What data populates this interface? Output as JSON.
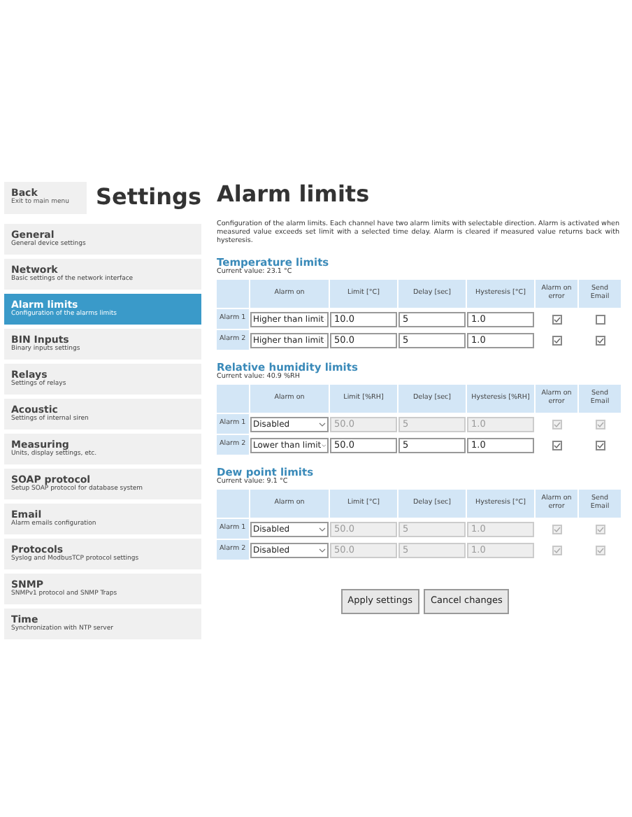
{
  "back": {
    "title": "Back",
    "subtitle": "Exit to main menu"
  },
  "settings_title": "Settings",
  "sidebar": {
    "items": [
      {
        "title": "General",
        "subtitle": "General device settings",
        "selected": false
      },
      {
        "title": "Network",
        "subtitle": "Basic settings of the network interface",
        "selected": false
      },
      {
        "title": "Alarm limits",
        "subtitle": "Configuration of the alarms limits",
        "selected": true
      },
      {
        "title": "BIN Inputs",
        "subtitle": "Binary inputs settings",
        "selected": false
      },
      {
        "title": "Relays",
        "subtitle": "Settings of relays",
        "selected": false
      },
      {
        "title": "Acoustic",
        "subtitle": "Settings of internal siren",
        "selected": false
      },
      {
        "title": "Measuring",
        "subtitle": "Units, display settings, etc.",
        "selected": false
      },
      {
        "title": "SOAP protocol",
        "subtitle": "Setup SOAP protocol for database system",
        "selected": false
      },
      {
        "title": "Email",
        "subtitle": "Alarm emails configuration",
        "selected": false
      },
      {
        "title": "Protocols",
        "subtitle": "Syslog and ModbusTCP protocol settings",
        "selected": false
      },
      {
        "title": "SNMP",
        "subtitle": "SNMPv1 protocol and SNMP Traps",
        "selected": false
      },
      {
        "title": "Time",
        "subtitle": "Synchronization with NTP server",
        "selected": false
      }
    ]
  },
  "page_title": "Alarm limits",
  "description": "Configuration of the alarm limits. Each channel have two alarm limits with selectable direction. Alarm is activated when measured value exceeds set limit with a selected time delay. Alarm is cleared if measured value returns back with hysteresis.",
  "sections": [
    {
      "title": "Temperature limits",
      "current": "Current value: 23.1 °C",
      "columns": [
        "Alarm on",
        "Limit [°C]",
        "Delay [sec]",
        "Hysteresis [°C]",
        "Alarm on error",
        "Send Email"
      ],
      "rows": [
        {
          "label": "Alarm 1",
          "alarm_on": "Higher than limit",
          "limit": "10.0",
          "delay": "5",
          "hysteresis": "1.0",
          "disabled": false,
          "alarm_on_error": true,
          "send_email": false
        },
        {
          "label": "Alarm 2",
          "alarm_on": "Higher than limit",
          "limit": "50.0",
          "delay": "5",
          "hysteresis": "1.0",
          "disabled": false,
          "alarm_on_error": true,
          "send_email": true
        }
      ]
    },
    {
      "title": "Relative humidity limits",
      "current": "Current value: 40.9 %RH",
      "columns": [
        "Alarm on",
        "Limit [%RH]",
        "Delay [sec]",
        "Hysteresis [%RH]",
        "Alarm on error",
        "Send Email"
      ],
      "rows": [
        {
          "label": "Alarm 1",
          "alarm_on": "Disabled",
          "limit": "50.0",
          "delay": "5",
          "hysteresis": "1.0",
          "disabled": true,
          "alarm_on_error": true,
          "send_email": true
        },
        {
          "label": "Alarm 2",
          "alarm_on": "Lower than limit",
          "limit": "50.0",
          "delay": "5",
          "hysteresis": "1.0",
          "disabled": false,
          "alarm_on_error": true,
          "send_email": true
        }
      ]
    },
    {
      "title": "Dew point limits",
      "current": "Current value: 9.1 °C",
      "columns": [
        "Alarm on",
        "Limit [°C]",
        "Delay [sec]",
        "Hysteresis [°C]",
        "Alarm on error",
        "Send Email"
      ],
      "rows": [
        {
          "label": "Alarm 1",
          "alarm_on": "Disabled",
          "limit": "50.0",
          "delay": "5",
          "hysteresis": "1.0",
          "disabled": true,
          "alarm_on_error": true,
          "send_email": true
        },
        {
          "label": "Alarm 2",
          "alarm_on": "Disabled",
          "limit": "50.0",
          "delay": "5",
          "hysteresis": "1.0",
          "disabled": true,
          "alarm_on_error": true,
          "send_email": true
        }
      ]
    }
  ],
  "buttons": [
    "Apply settings",
    "Cancel changes"
  ]
}
